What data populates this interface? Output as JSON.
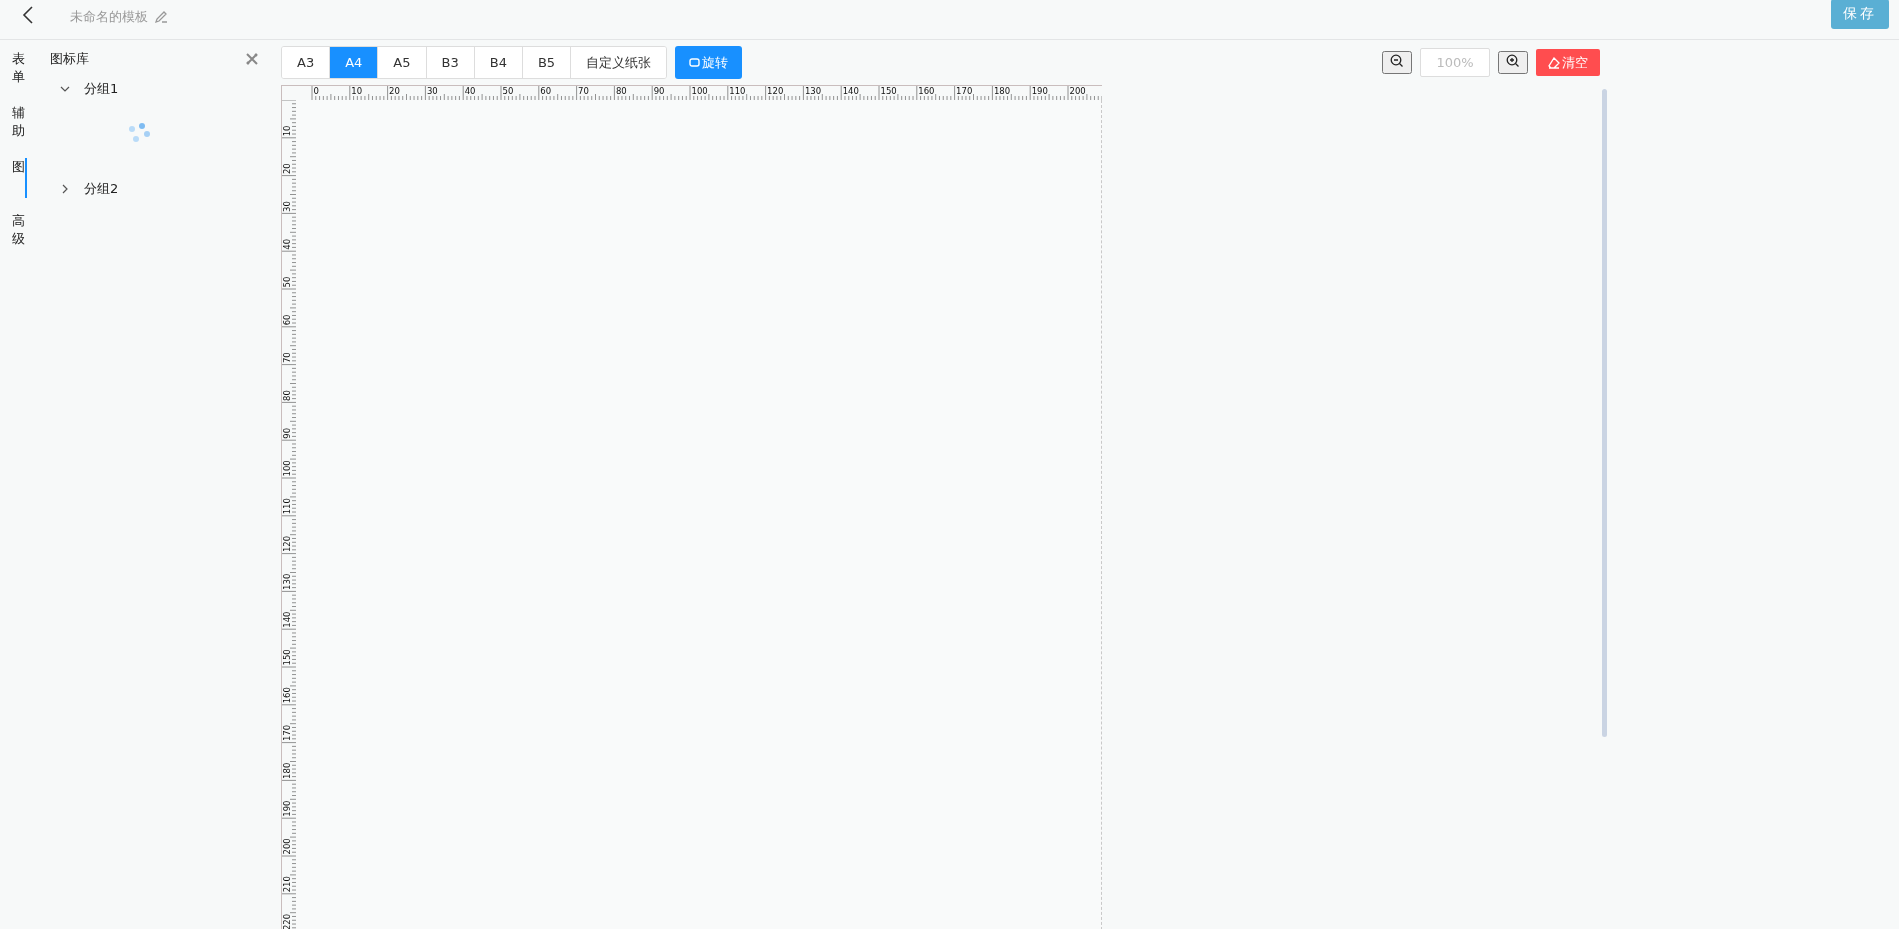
{
  "header": {
    "title": "未命名的模板",
    "save_button": "保存"
  },
  "side_tabs": [
    {
      "label": "表单",
      "selected": false
    },
    {
      "label": "辅助",
      "selected": false
    },
    {
      "label": "图",
      "selected": true
    },
    {
      "label": "高级",
      "selected": false
    }
  ],
  "panel": {
    "title": "图标库",
    "groups": [
      {
        "label": "分组1",
        "expanded": true
      },
      {
        "label": "分组2",
        "expanded": false
      }
    ]
  },
  "paper_sizes": [
    {
      "label": "A3",
      "selected": false
    },
    {
      "label": "A4",
      "selected": true
    },
    {
      "label": "A5",
      "selected": false
    },
    {
      "label": "B3",
      "selected": false
    },
    {
      "label": "B4",
      "selected": false
    },
    {
      "label": "B5",
      "selected": false
    },
    {
      "label": "自定义纸张",
      "selected": false
    }
  ],
  "rotate_button": "旋转",
  "zoom": {
    "placeholder": "100%"
  },
  "clear_button": "清空",
  "ruler": {
    "top_labels": [
      "0",
      "10",
      "20",
      "30",
      "40",
      "50",
      "60",
      "70",
      "80",
      "90",
      "100",
      "110",
      "120",
      "130",
      "140",
      "150",
      "160",
      "170",
      "180",
      "190",
      "200"
    ],
    "left_labels": [
      "10",
      "20",
      "30",
      "40",
      "50",
      "60",
      "70",
      "80",
      "90",
      "100",
      "110",
      "120",
      "130",
      "140",
      "150",
      "160",
      "170",
      "180",
      "190",
      "200",
      "210",
      "220"
    ]
  }
}
